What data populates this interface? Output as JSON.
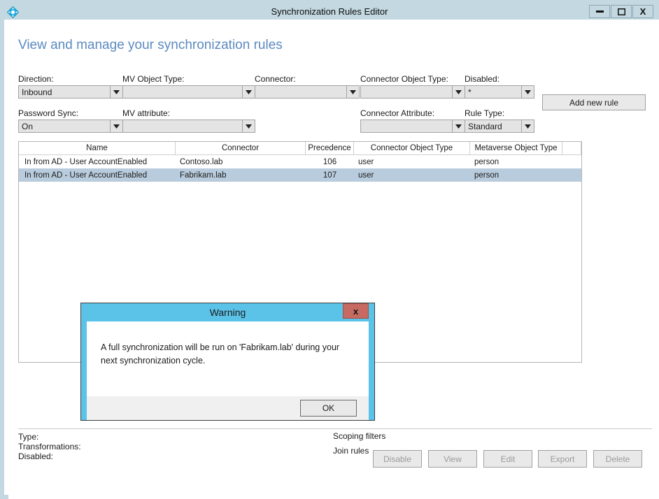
{
  "window": {
    "title": "Synchronization Rules Editor",
    "app_icon": "sync-diamond-icon",
    "minimize_label": "–",
    "maximize_label": "□",
    "close_label": "X"
  },
  "page": {
    "heading": "View and manage your synchronization rules"
  },
  "filters": [
    {
      "label": "Direction:",
      "value": "Inbound"
    },
    {
      "label": "MV Object Type:",
      "value": ""
    },
    {
      "label": "Connector:",
      "value": ""
    },
    {
      "label": "Connector Object Type:",
      "value": ""
    },
    {
      "label": "Disabled:",
      "value": "*"
    },
    {
      "label": "Password Sync:",
      "value": "On"
    },
    {
      "label": "MV attribute:",
      "value": ""
    },
    {
      "label": "Connector Attribute:",
      "value": ""
    },
    {
      "label": "Rule Type:",
      "value": "Standard"
    }
  ],
  "toolbar": {
    "add_new_rule_label": "Add new rule"
  },
  "grid": {
    "columns": [
      "Name",
      "Connector",
      "Precedence",
      "Connector Object Type",
      "Metaverse Object Type"
    ],
    "rows": [
      {
        "name": "In from AD - User AccountEnabled",
        "connector": "Contoso.lab",
        "precedence": "106",
        "connector_object_type": "user",
        "metaverse_object_type": "person",
        "selected": false
      },
      {
        "name": "In from AD - User AccountEnabled",
        "connector": "Fabrikam.lab",
        "precedence": "107",
        "connector_object_type": "user",
        "metaverse_object_type": "person",
        "selected": true
      }
    ]
  },
  "details": {
    "type_label": "Type:",
    "transformations_label": "Transformations:",
    "disabled_label": "Disabled:",
    "scoping_filters_label": "Scoping filters",
    "join_rules_label": "Join rules"
  },
  "actions": [
    {
      "label": "Disable",
      "disabled": true
    },
    {
      "label": "View",
      "disabled": true
    },
    {
      "label": "Edit",
      "disabled": true
    },
    {
      "label": "Export",
      "disabled": true
    },
    {
      "label": "Delete",
      "disabled": true
    }
  ],
  "dialog": {
    "title": "Warning",
    "close_label": "x",
    "message": "A full synchronization will be run on 'Fabrikam.lab' during your next synchronization cycle.",
    "ok_label": "OK"
  },
  "colors": {
    "title_bar": "#c3d8e0",
    "heading": "#5b8ac0",
    "dialog_border": "#5bc3e8",
    "dialog_close": "#c76a61",
    "row_selected": "#b9ccdd"
  }
}
